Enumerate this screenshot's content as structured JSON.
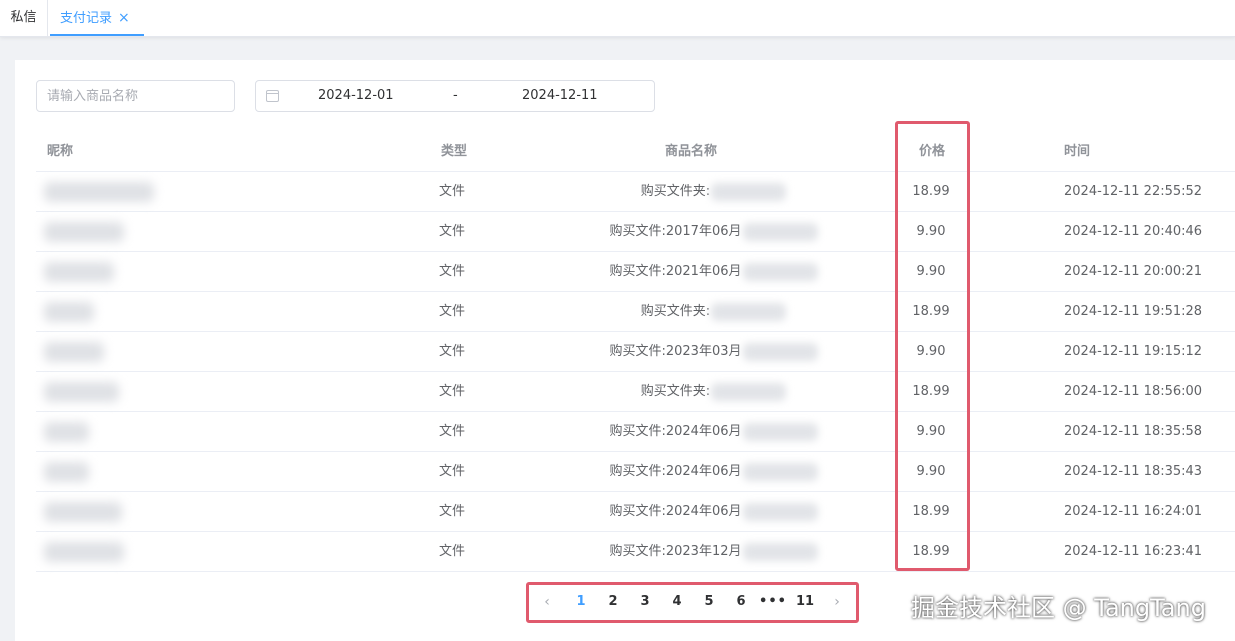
{
  "tabs": [
    {
      "label": "私信"
    },
    {
      "label": "支付记录",
      "close": "×"
    }
  ],
  "filters": {
    "search_placeholder": "请输入商品名称",
    "date_start": "2024-12-01",
    "date_separator": "-",
    "date_end": "2024-12-11"
  },
  "table": {
    "headers": {
      "nick": "昵称",
      "type": "类型",
      "goods": "商品名称",
      "price": "价格",
      "time": "时间"
    },
    "rows": [
      {
        "type": "文件",
        "goods": "购买文件夹:",
        "price": "18.99",
        "time": "2024-12-11 22:55:52"
      },
      {
        "type": "文件",
        "goods": "购买文件:2017年06月",
        "price": "9.90",
        "time": "2024-12-11 20:40:46"
      },
      {
        "type": "文件",
        "goods": "购买文件:2021年06月",
        "price": "9.90",
        "time": "2024-12-11 20:00:21"
      },
      {
        "type": "文件",
        "goods": "购买文件夹:",
        "price": "18.99",
        "time": "2024-12-11 19:51:28"
      },
      {
        "type": "文件",
        "goods": "购买文件:2023年03月",
        "price": "9.90",
        "time": "2024-12-11 19:15:12"
      },
      {
        "type": "文件",
        "goods": "购买文件夹:",
        "price": "18.99",
        "time": "2024-12-11 18:56:00"
      },
      {
        "type": "文件",
        "goods": "购买文件:2024年06月",
        "price": "9.90",
        "time": "2024-12-11 18:35:58"
      },
      {
        "type": "文件",
        "goods": "购买文件:2024年06月",
        "price": "9.90",
        "time": "2024-12-11 18:35:43"
      },
      {
        "type": "文件",
        "goods": "购买文件:2024年06月",
        "price": "18.99",
        "time": "2024-12-11 16:24:01"
      },
      {
        "type": "文件",
        "goods": "购买文件:2023年12月",
        "price": "18.99",
        "time": "2024-12-11 16:23:41"
      }
    ]
  },
  "pagination": {
    "prev": "‹",
    "pages": [
      "1",
      "2",
      "3",
      "4",
      "5",
      "6"
    ],
    "more": "•••",
    "last": "11",
    "next": "›",
    "current": "1"
  },
  "watermark": "掘金技术社区 @ TangTang",
  "colors": {
    "accent": "#409eff",
    "highlight": "#e05a6d"
  }
}
